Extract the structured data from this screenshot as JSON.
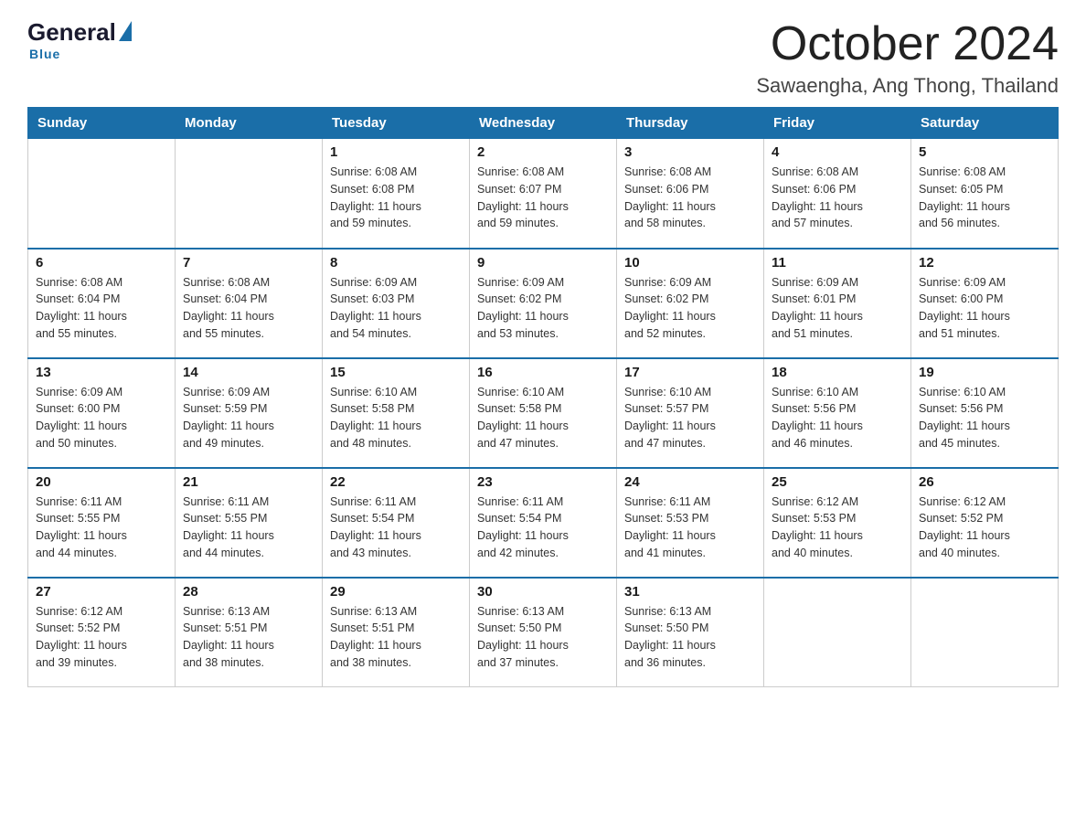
{
  "logo": {
    "general": "General",
    "blue": "Blue",
    "tagline": "Blue"
  },
  "header": {
    "month": "October 2024",
    "location": "Sawaengha, Ang Thong, Thailand"
  },
  "weekdays": [
    "Sunday",
    "Monday",
    "Tuesday",
    "Wednesday",
    "Thursday",
    "Friday",
    "Saturday"
  ],
  "weeks": [
    [
      {
        "day": "",
        "sunrise": "",
        "sunset": "",
        "daylight": ""
      },
      {
        "day": "",
        "sunrise": "",
        "sunset": "",
        "daylight": ""
      },
      {
        "day": "1",
        "sunrise": "Sunrise: 6:08 AM",
        "sunset": "Sunset: 6:08 PM",
        "daylight": "Daylight: 11 hours and 59 minutes."
      },
      {
        "day": "2",
        "sunrise": "Sunrise: 6:08 AM",
        "sunset": "Sunset: 6:07 PM",
        "daylight": "Daylight: 11 hours and 59 minutes."
      },
      {
        "day": "3",
        "sunrise": "Sunrise: 6:08 AM",
        "sunset": "Sunset: 6:06 PM",
        "daylight": "Daylight: 11 hours and 58 minutes."
      },
      {
        "day": "4",
        "sunrise": "Sunrise: 6:08 AM",
        "sunset": "Sunset: 6:06 PM",
        "daylight": "Daylight: 11 hours and 57 minutes."
      },
      {
        "day": "5",
        "sunrise": "Sunrise: 6:08 AM",
        "sunset": "Sunset: 6:05 PM",
        "daylight": "Daylight: 11 hours and 56 minutes."
      }
    ],
    [
      {
        "day": "6",
        "sunrise": "Sunrise: 6:08 AM",
        "sunset": "Sunset: 6:04 PM",
        "daylight": "Daylight: 11 hours and 55 minutes."
      },
      {
        "day": "7",
        "sunrise": "Sunrise: 6:08 AM",
        "sunset": "Sunset: 6:04 PM",
        "daylight": "Daylight: 11 hours and 55 minutes."
      },
      {
        "day": "8",
        "sunrise": "Sunrise: 6:09 AM",
        "sunset": "Sunset: 6:03 PM",
        "daylight": "Daylight: 11 hours and 54 minutes."
      },
      {
        "day": "9",
        "sunrise": "Sunrise: 6:09 AM",
        "sunset": "Sunset: 6:02 PM",
        "daylight": "Daylight: 11 hours and 53 minutes."
      },
      {
        "day": "10",
        "sunrise": "Sunrise: 6:09 AM",
        "sunset": "Sunset: 6:02 PM",
        "daylight": "Daylight: 11 hours and 52 minutes."
      },
      {
        "day": "11",
        "sunrise": "Sunrise: 6:09 AM",
        "sunset": "Sunset: 6:01 PM",
        "daylight": "Daylight: 11 hours and 51 minutes."
      },
      {
        "day": "12",
        "sunrise": "Sunrise: 6:09 AM",
        "sunset": "Sunset: 6:00 PM",
        "daylight": "Daylight: 11 hours and 51 minutes."
      }
    ],
    [
      {
        "day": "13",
        "sunrise": "Sunrise: 6:09 AM",
        "sunset": "Sunset: 6:00 PM",
        "daylight": "Daylight: 11 hours and 50 minutes."
      },
      {
        "day": "14",
        "sunrise": "Sunrise: 6:09 AM",
        "sunset": "Sunset: 5:59 PM",
        "daylight": "Daylight: 11 hours and 49 minutes."
      },
      {
        "day": "15",
        "sunrise": "Sunrise: 6:10 AM",
        "sunset": "Sunset: 5:58 PM",
        "daylight": "Daylight: 11 hours and 48 minutes."
      },
      {
        "day": "16",
        "sunrise": "Sunrise: 6:10 AM",
        "sunset": "Sunset: 5:58 PM",
        "daylight": "Daylight: 11 hours and 47 minutes."
      },
      {
        "day": "17",
        "sunrise": "Sunrise: 6:10 AM",
        "sunset": "Sunset: 5:57 PM",
        "daylight": "Daylight: 11 hours and 47 minutes."
      },
      {
        "day": "18",
        "sunrise": "Sunrise: 6:10 AM",
        "sunset": "Sunset: 5:56 PM",
        "daylight": "Daylight: 11 hours and 46 minutes."
      },
      {
        "day": "19",
        "sunrise": "Sunrise: 6:10 AM",
        "sunset": "Sunset: 5:56 PM",
        "daylight": "Daylight: 11 hours and 45 minutes."
      }
    ],
    [
      {
        "day": "20",
        "sunrise": "Sunrise: 6:11 AM",
        "sunset": "Sunset: 5:55 PM",
        "daylight": "Daylight: 11 hours and 44 minutes."
      },
      {
        "day": "21",
        "sunrise": "Sunrise: 6:11 AM",
        "sunset": "Sunset: 5:55 PM",
        "daylight": "Daylight: 11 hours and 44 minutes."
      },
      {
        "day": "22",
        "sunrise": "Sunrise: 6:11 AM",
        "sunset": "Sunset: 5:54 PM",
        "daylight": "Daylight: 11 hours and 43 minutes."
      },
      {
        "day": "23",
        "sunrise": "Sunrise: 6:11 AM",
        "sunset": "Sunset: 5:54 PM",
        "daylight": "Daylight: 11 hours and 42 minutes."
      },
      {
        "day": "24",
        "sunrise": "Sunrise: 6:11 AM",
        "sunset": "Sunset: 5:53 PM",
        "daylight": "Daylight: 11 hours and 41 minutes."
      },
      {
        "day": "25",
        "sunrise": "Sunrise: 6:12 AM",
        "sunset": "Sunset: 5:53 PM",
        "daylight": "Daylight: 11 hours and 40 minutes."
      },
      {
        "day": "26",
        "sunrise": "Sunrise: 6:12 AM",
        "sunset": "Sunset: 5:52 PM",
        "daylight": "Daylight: 11 hours and 40 minutes."
      }
    ],
    [
      {
        "day": "27",
        "sunrise": "Sunrise: 6:12 AM",
        "sunset": "Sunset: 5:52 PM",
        "daylight": "Daylight: 11 hours and 39 minutes."
      },
      {
        "day": "28",
        "sunrise": "Sunrise: 6:13 AM",
        "sunset": "Sunset: 5:51 PM",
        "daylight": "Daylight: 11 hours and 38 minutes."
      },
      {
        "day": "29",
        "sunrise": "Sunrise: 6:13 AM",
        "sunset": "Sunset: 5:51 PM",
        "daylight": "Daylight: 11 hours and 38 minutes."
      },
      {
        "day": "30",
        "sunrise": "Sunrise: 6:13 AM",
        "sunset": "Sunset: 5:50 PM",
        "daylight": "Daylight: 11 hours and 37 minutes."
      },
      {
        "day": "31",
        "sunrise": "Sunrise: 6:13 AM",
        "sunset": "Sunset: 5:50 PM",
        "daylight": "Daylight: 11 hours and 36 minutes."
      },
      {
        "day": "",
        "sunrise": "",
        "sunset": "",
        "daylight": ""
      },
      {
        "day": "",
        "sunrise": "",
        "sunset": "",
        "daylight": ""
      }
    ]
  ]
}
